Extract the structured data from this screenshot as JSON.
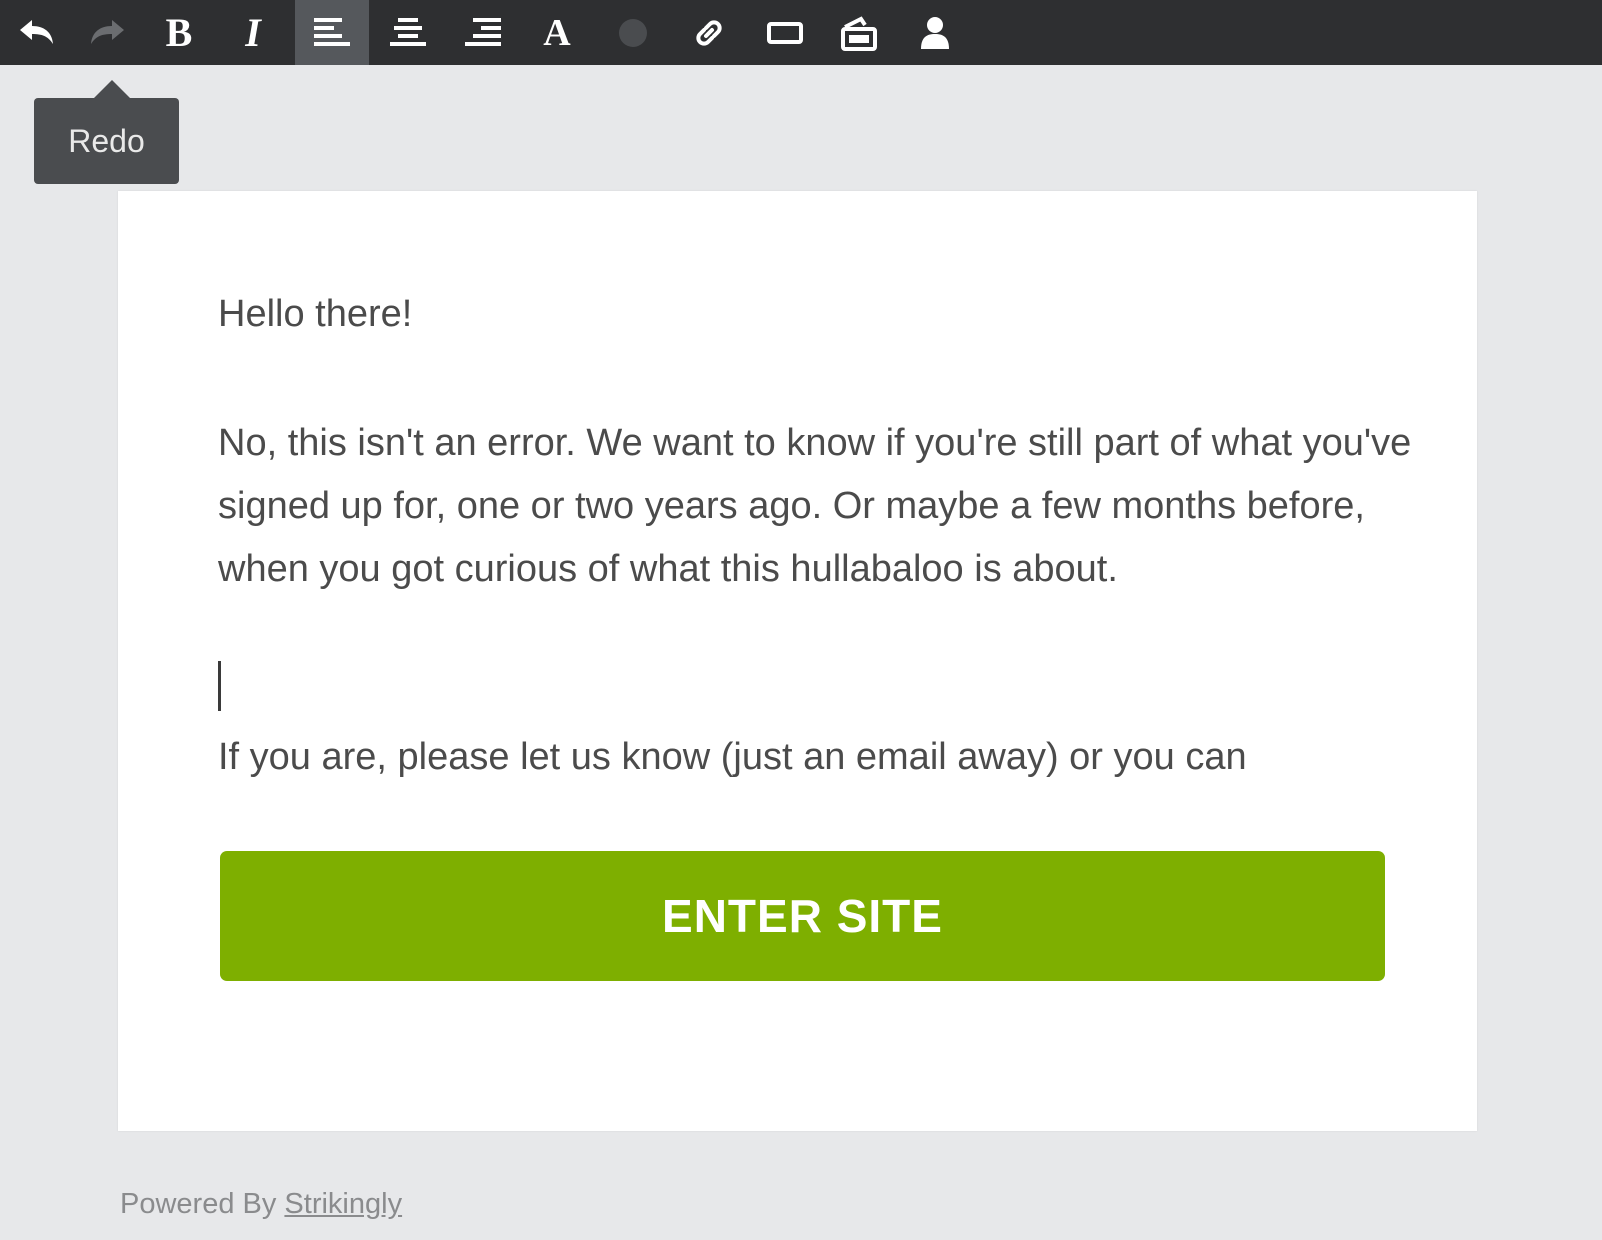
{
  "toolbar": {
    "buttons": [
      {
        "name": "undo",
        "icon": "undo-icon"
      },
      {
        "name": "redo",
        "icon": "redo-icon"
      },
      {
        "name": "bold",
        "label": "B",
        "icon": "bold-icon"
      },
      {
        "name": "italic",
        "label": "I",
        "icon": "italic-icon"
      },
      {
        "name": "align-left",
        "icon": "align-left-icon",
        "active": true
      },
      {
        "name": "align-center",
        "icon": "align-center-icon"
      },
      {
        "name": "align-right",
        "icon": "align-right-icon"
      },
      {
        "name": "font",
        "label": "A",
        "icon": "font-icon"
      },
      {
        "name": "color",
        "icon": "color-circle-icon"
      },
      {
        "name": "link",
        "icon": "link-icon"
      },
      {
        "name": "button",
        "icon": "button-icon"
      },
      {
        "name": "media",
        "icon": "media-icon"
      },
      {
        "name": "person",
        "icon": "person-icon"
      }
    ],
    "bold_label": "B",
    "italic_label": "I",
    "font_label": "A",
    "background": "#2e2f31",
    "active_background": "#55585c"
  },
  "tooltip": {
    "text": "Redo"
  },
  "content": {
    "greeting": "Hello there!",
    "paragraph": "No, this isn't an error. We want to know if you're still part of what you've signed up for, one or two years ago. Or maybe a few months before, when you got curious of what this hullabaloo is about.",
    "follow_up": "If  you are, please let us know (just an email away) or you can"
  },
  "enter_button": {
    "label": "ENTER SITE",
    "color": "#7eaf00"
  },
  "footer": {
    "prefix": "Powered By ",
    "link": "Strikingly"
  }
}
